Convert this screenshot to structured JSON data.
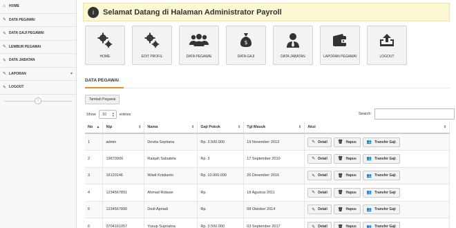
{
  "sidebar": {
    "items": [
      {
        "label": "HOME",
        "icon": "home-icon",
        "glyph": "⌂"
      },
      {
        "label": "DATA PEGAWAI",
        "icon": "pencil-icon",
        "glyph": "✎"
      },
      {
        "label": "DATA GAJI PEGAWAI",
        "icon": "pencil-icon",
        "glyph": "✎"
      },
      {
        "label": "LEMBUR PEGAWAI",
        "icon": "pencil-icon",
        "glyph": "✎"
      },
      {
        "label": "DATA JABATAN",
        "icon": "pencil-icon",
        "glyph": "✎"
      },
      {
        "label": "LAPORAN",
        "icon": "pencil-icon",
        "glyph": "✎",
        "has_caret": true
      },
      {
        "label": "LOGOUT",
        "icon": "pencil-icon",
        "glyph": "✎"
      }
    ],
    "collapse_glyph": "‹"
  },
  "header": {
    "welcome_text": "Selamat Datang di Halaman Administrator Payroll",
    "welcome_icon": "info-icon"
  },
  "shortcuts": [
    {
      "label": "HOME",
      "icon": "gears-icon"
    },
    {
      "label": "EDIT PROFIL",
      "icon": "gears-icon"
    },
    {
      "label": "DATA PEGAWAI",
      "icon": "users-group-icon"
    },
    {
      "label": "DATA GAJI",
      "icon": "money-bag-icon"
    },
    {
      "label": "DATA JABATAN",
      "icon": "user-tie-icon"
    },
    {
      "label": "LAPORAN PEGAWAI",
      "icon": "wallet-icon"
    },
    {
      "label": "LOGOUT",
      "icon": "upload-icon"
    }
  ],
  "section": {
    "title": "DATA PEGAWAI",
    "add_button": "Tambah Pegawai"
  },
  "table_controls": {
    "show_label": "Show",
    "page_length": "10",
    "entries_label": "entries",
    "search_label": "Search:"
  },
  "table": {
    "columns": [
      "No",
      "Nip",
      "Nama",
      "Gaji Pokok",
      "Tgl Masuk",
      "Aksi"
    ],
    "rows": [
      {
        "no": "1",
        "nip": "admin",
        "nama": "Devita Septiana",
        "gaji": "Rp. 3.500.000",
        "tgl": "19 November 2013"
      },
      {
        "no": "2",
        "nip": "19870909",
        "nama": "Raiqah Salsabila",
        "gaji": "Rp. 3",
        "tgl": "17 September 2010"
      },
      {
        "no": "3",
        "nip": "16120146",
        "nama": "Wiwit Kristianto",
        "gaji": "Rp. 10.000.000",
        "tgl": "26 Desember 2016"
      },
      {
        "no": "4",
        "nip": "1234567891",
        "nama": "Ahmad Ridwan",
        "gaji": "Rp.",
        "tgl": "18 Agustus 2011"
      },
      {
        "no": "5",
        "nip": "1234567890",
        "nama": "Dedi Apriadi",
        "gaji": "Rp.",
        "tgl": "08 Oktober 2014"
      },
      {
        "no": "6",
        "nip": "0704161057",
        "nama": "Yusup Supriatna",
        "gaji": "Rp. 3.500.000",
        "tgl": "03 September 2017"
      }
    ],
    "actions": {
      "detail": "Detail",
      "hapus": "Hapus",
      "transfer": "Transfer Gaji"
    }
  }
}
